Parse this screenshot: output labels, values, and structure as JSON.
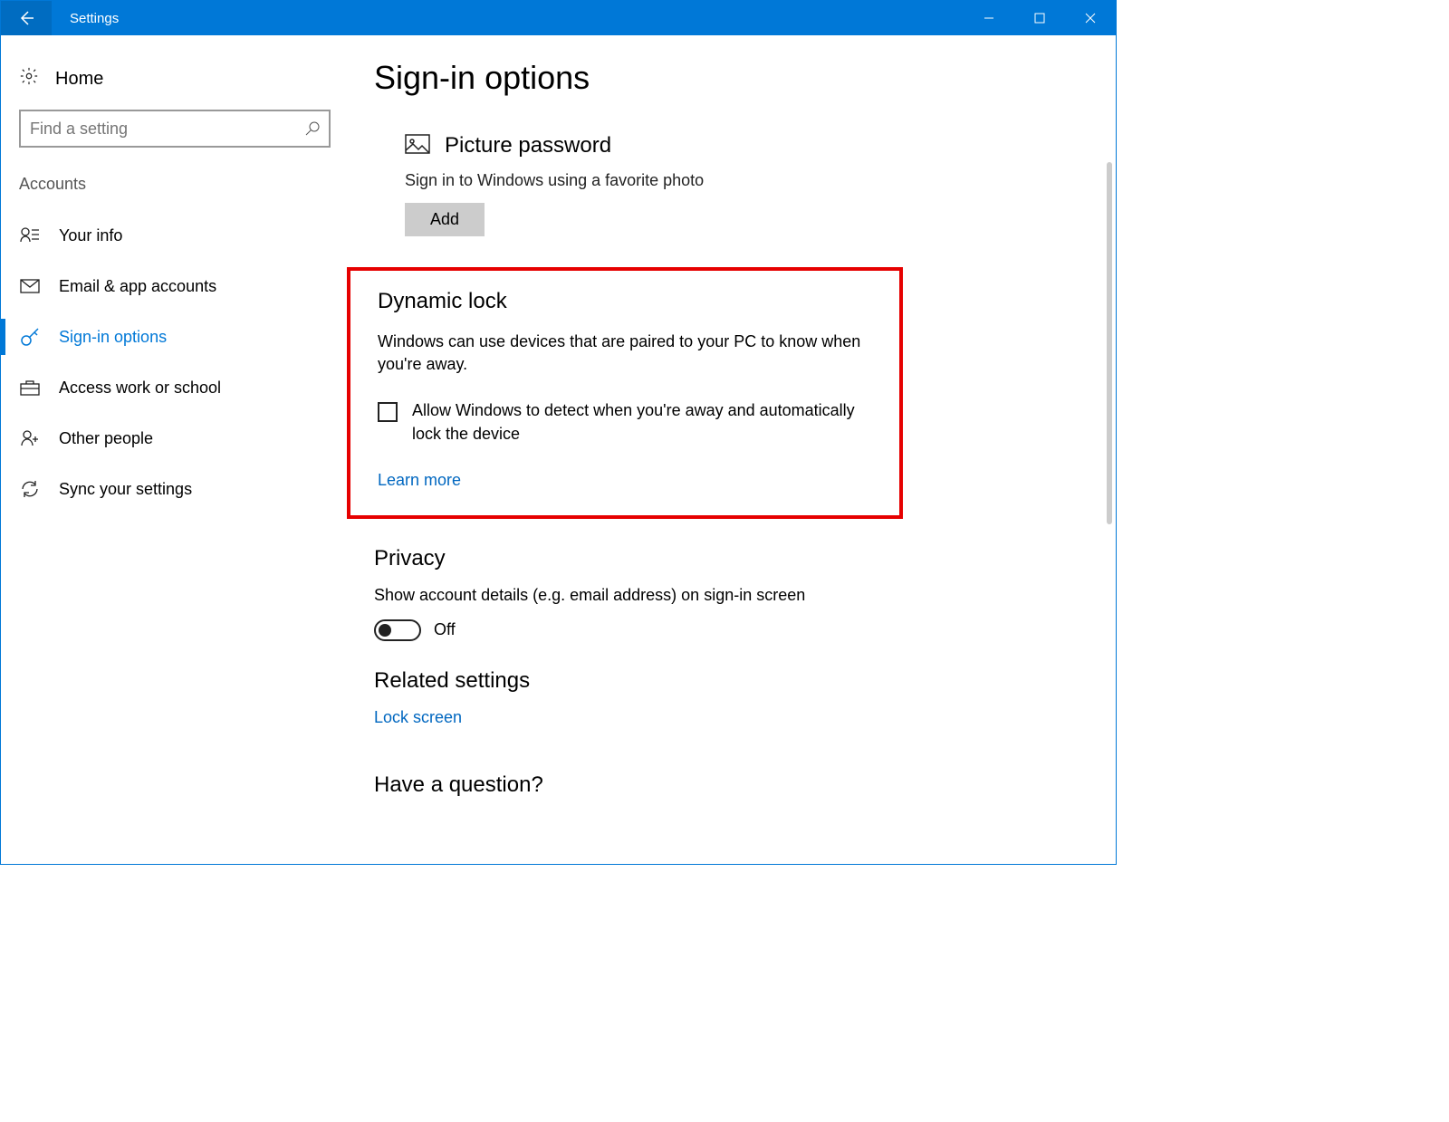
{
  "titlebar": {
    "title": "Settings"
  },
  "sidebar": {
    "home": "Home",
    "search_placeholder": "Find a setting",
    "category": "Accounts",
    "items": [
      {
        "label": "Your info"
      },
      {
        "label": "Email & app accounts"
      },
      {
        "label": "Sign-in options"
      },
      {
        "label": "Access work or school"
      },
      {
        "label": "Other people"
      },
      {
        "label": "Sync your settings"
      }
    ]
  },
  "main": {
    "title": "Sign-in options",
    "picture_password": {
      "heading": "Picture password",
      "desc": "Sign in to Windows using a favorite photo",
      "button": "Add"
    },
    "dynamic_lock": {
      "heading": "Dynamic lock",
      "desc": "Windows can use devices that are paired to your PC to know when you're away.",
      "checkbox_label": "Allow Windows to detect when you're away and automatically lock the device",
      "learn_more": "Learn more"
    },
    "privacy": {
      "heading": "Privacy",
      "desc": "Show account details (e.g. email address) on sign-in screen",
      "toggle_state": "Off"
    },
    "related": {
      "heading": "Related settings",
      "link": "Lock screen"
    },
    "question": {
      "heading": "Have a question?"
    }
  }
}
